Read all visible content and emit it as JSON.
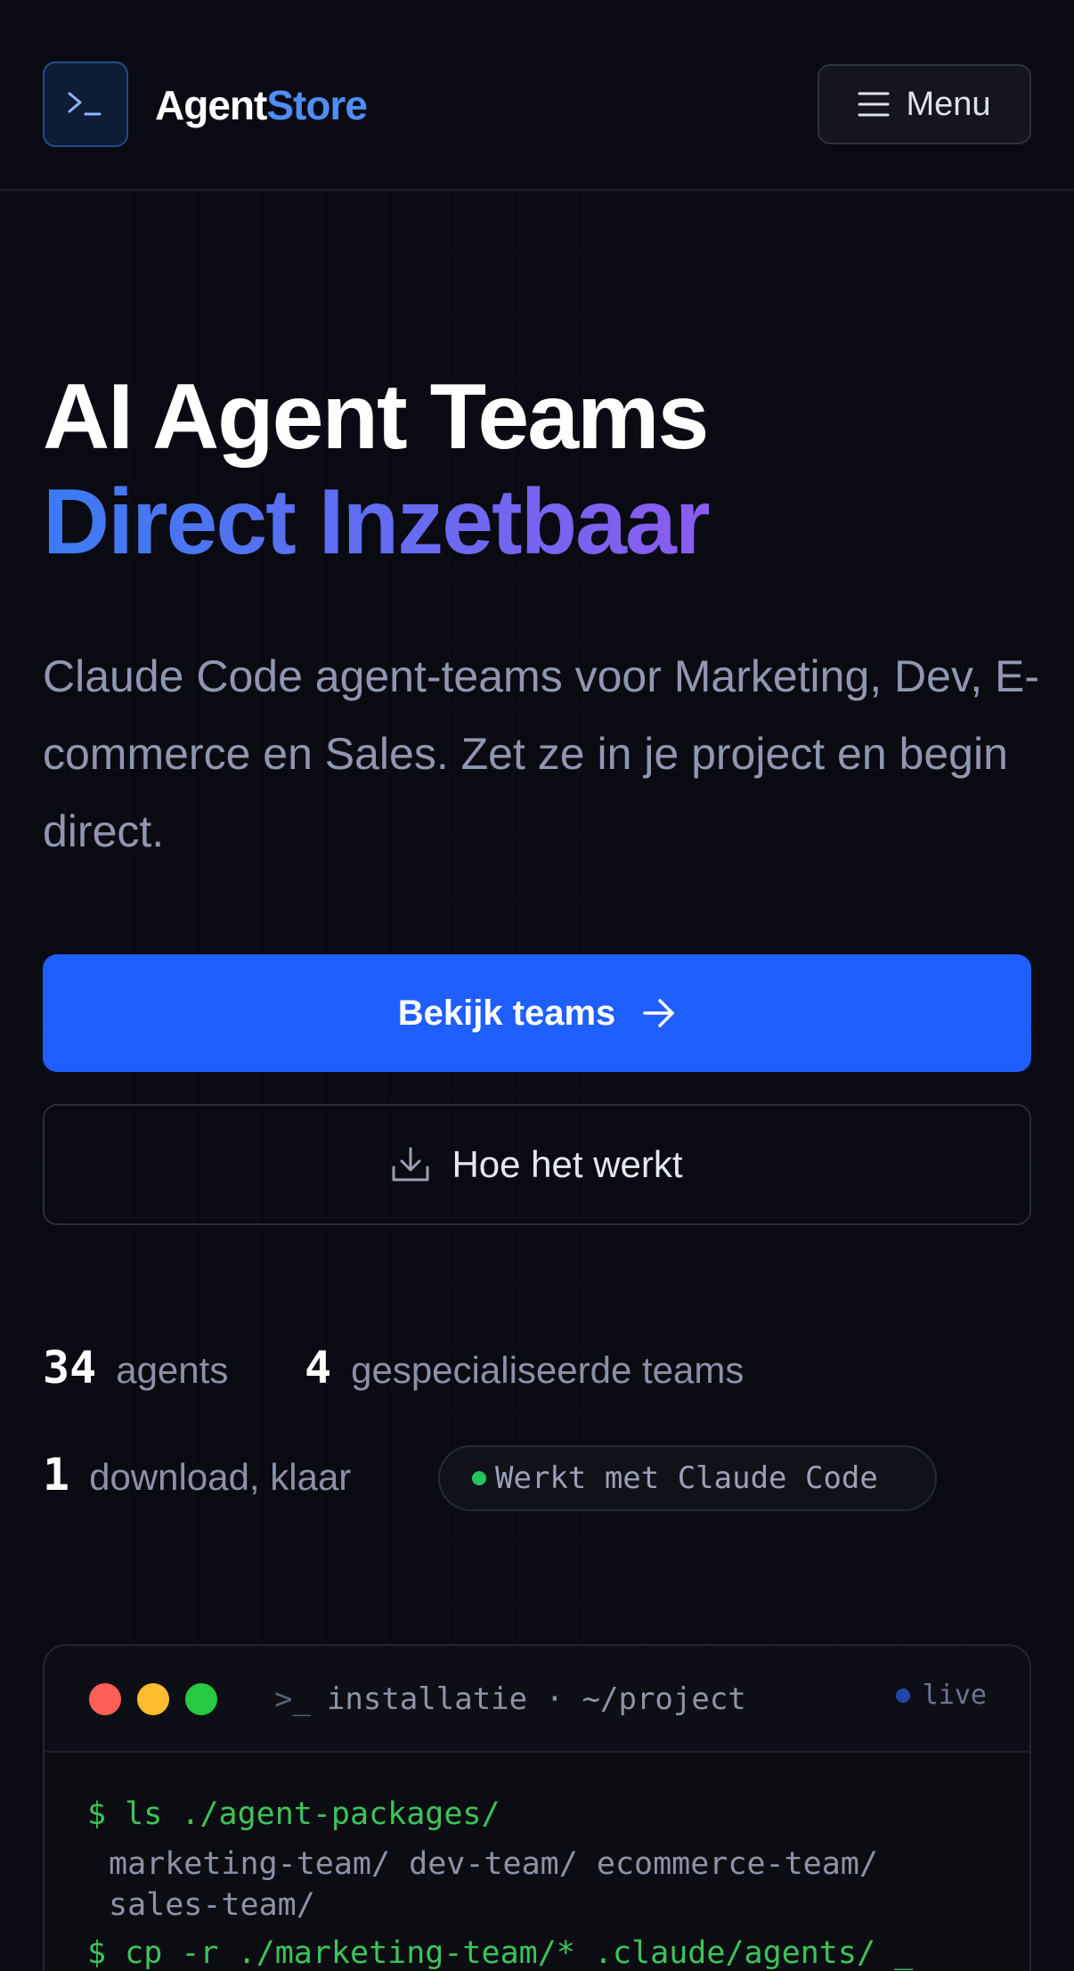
{
  "header": {
    "brand_primary": "Agent",
    "brand_accent": "Store",
    "menu_label": "Menu"
  },
  "hero": {
    "title_line1": "AI Agent Teams",
    "title_line2": "Direct Inzetbaar",
    "lead": "Claude Code agent-teams voor Marketing, Dev, E-commerce en Sales. Zet ze in je project en begin direct.",
    "cta_primary": "Bekijk teams",
    "cta_secondary": "Hoe het werkt"
  },
  "stats": [
    {
      "value": "34",
      "label": "agents"
    },
    {
      "value": "4",
      "label": "gespecialiseerde teams"
    },
    {
      "value": "1",
      "label": "download, klaar"
    }
  ],
  "badge": {
    "text": "Werkt met Claude Code",
    "status_color": "#22c55e"
  },
  "terminal": {
    "prompt_icon": ">_",
    "title": "installatie · ~/project",
    "status": "live",
    "lines": [
      {
        "type": "cmd",
        "text": "$ ls ./agent-packages/"
      },
      {
        "type": "out",
        "text": "marketing-team/ dev-team/ ecommerce-team/ sales-team/"
      },
      {
        "type": "cmd",
        "text": "$ cp -r ./marketing-team/* .claude/agents/ _"
      }
    ]
  },
  "colors": {
    "background": "#0a0b12",
    "accent_blue": "#1f5eff",
    "brand_blue": "#4f8df7",
    "gradient_start": "#3b7bf3",
    "gradient_end": "#8b5cf0",
    "traffic_red": "#ff5f57",
    "traffic_yellow": "#febc2e",
    "traffic_green": "#28c840"
  },
  "icons": [
    "terminal-icon",
    "hamburger-icon",
    "arrow-right-icon",
    "download-icon"
  ]
}
